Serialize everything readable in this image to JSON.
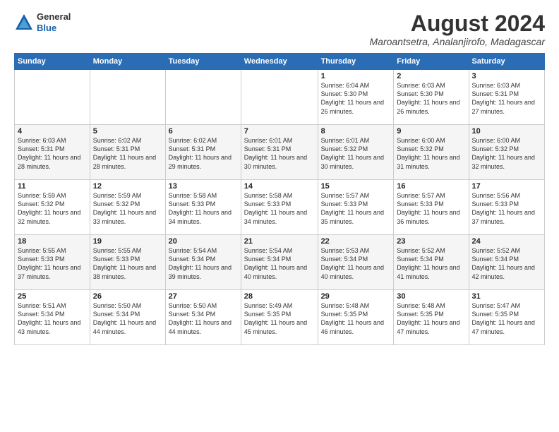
{
  "logo": {
    "general": "General",
    "blue": "Blue"
  },
  "title": {
    "month_year": "August 2024",
    "location": "Maroantsetra, Analanjirofo, Madagascar"
  },
  "days_of_week": [
    "Sunday",
    "Monday",
    "Tuesday",
    "Wednesday",
    "Thursday",
    "Friday",
    "Saturday"
  ],
  "weeks": [
    [
      {
        "day": "",
        "info": ""
      },
      {
        "day": "",
        "info": ""
      },
      {
        "day": "",
        "info": ""
      },
      {
        "day": "",
        "info": ""
      },
      {
        "day": "1",
        "info": "Sunrise: 6:04 AM\nSunset: 5:30 PM\nDaylight: 11 hours and 26 minutes."
      },
      {
        "day": "2",
        "info": "Sunrise: 6:03 AM\nSunset: 5:30 PM\nDaylight: 11 hours and 26 minutes."
      },
      {
        "day": "3",
        "info": "Sunrise: 6:03 AM\nSunset: 5:31 PM\nDaylight: 11 hours and 27 minutes."
      }
    ],
    [
      {
        "day": "4",
        "info": "Sunrise: 6:03 AM\nSunset: 5:31 PM\nDaylight: 11 hours and 28 minutes."
      },
      {
        "day": "5",
        "info": "Sunrise: 6:02 AM\nSunset: 5:31 PM\nDaylight: 11 hours and 28 minutes."
      },
      {
        "day": "6",
        "info": "Sunrise: 6:02 AM\nSunset: 5:31 PM\nDaylight: 11 hours and 29 minutes."
      },
      {
        "day": "7",
        "info": "Sunrise: 6:01 AM\nSunset: 5:31 PM\nDaylight: 11 hours and 30 minutes."
      },
      {
        "day": "8",
        "info": "Sunrise: 6:01 AM\nSunset: 5:32 PM\nDaylight: 11 hours and 30 minutes."
      },
      {
        "day": "9",
        "info": "Sunrise: 6:00 AM\nSunset: 5:32 PM\nDaylight: 11 hours and 31 minutes."
      },
      {
        "day": "10",
        "info": "Sunrise: 6:00 AM\nSunset: 5:32 PM\nDaylight: 11 hours and 32 minutes."
      }
    ],
    [
      {
        "day": "11",
        "info": "Sunrise: 5:59 AM\nSunset: 5:32 PM\nDaylight: 11 hours and 32 minutes."
      },
      {
        "day": "12",
        "info": "Sunrise: 5:59 AM\nSunset: 5:32 PM\nDaylight: 11 hours and 33 minutes."
      },
      {
        "day": "13",
        "info": "Sunrise: 5:58 AM\nSunset: 5:33 PM\nDaylight: 11 hours and 34 minutes."
      },
      {
        "day": "14",
        "info": "Sunrise: 5:58 AM\nSunset: 5:33 PM\nDaylight: 11 hours and 34 minutes."
      },
      {
        "day": "15",
        "info": "Sunrise: 5:57 AM\nSunset: 5:33 PM\nDaylight: 11 hours and 35 minutes."
      },
      {
        "day": "16",
        "info": "Sunrise: 5:57 AM\nSunset: 5:33 PM\nDaylight: 11 hours and 36 minutes."
      },
      {
        "day": "17",
        "info": "Sunrise: 5:56 AM\nSunset: 5:33 PM\nDaylight: 11 hours and 37 minutes."
      }
    ],
    [
      {
        "day": "18",
        "info": "Sunrise: 5:55 AM\nSunset: 5:33 PM\nDaylight: 11 hours and 37 minutes."
      },
      {
        "day": "19",
        "info": "Sunrise: 5:55 AM\nSunset: 5:33 PM\nDaylight: 11 hours and 38 minutes."
      },
      {
        "day": "20",
        "info": "Sunrise: 5:54 AM\nSunset: 5:34 PM\nDaylight: 11 hours and 39 minutes."
      },
      {
        "day": "21",
        "info": "Sunrise: 5:54 AM\nSunset: 5:34 PM\nDaylight: 11 hours and 40 minutes."
      },
      {
        "day": "22",
        "info": "Sunrise: 5:53 AM\nSunset: 5:34 PM\nDaylight: 11 hours and 40 minutes."
      },
      {
        "day": "23",
        "info": "Sunrise: 5:52 AM\nSunset: 5:34 PM\nDaylight: 11 hours and 41 minutes."
      },
      {
        "day": "24",
        "info": "Sunrise: 5:52 AM\nSunset: 5:34 PM\nDaylight: 11 hours and 42 minutes."
      }
    ],
    [
      {
        "day": "25",
        "info": "Sunrise: 5:51 AM\nSunset: 5:34 PM\nDaylight: 11 hours and 43 minutes."
      },
      {
        "day": "26",
        "info": "Sunrise: 5:50 AM\nSunset: 5:34 PM\nDaylight: 11 hours and 44 minutes."
      },
      {
        "day": "27",
        "info": "Sunrise: 5:50 AM\nSunset: 5:34 PM\nDaylight: 11 hours and 44 minutes."
      },
      {
        "day": "28",
        "info": "Sunrise: 5:49 AM\nSunset: 5:35 PM\nDaylight: 11 hours and 45 minutes."
      },
      {
        "day": "29",
        "info": "Sunrise: 5:48 AM\nSunset: 5:35 PM\nDaylight: 11 hours and 46 minutes."
      },
      {
        "day": "30",
        "info": "Sunrise: 5:48 AM\nSunset: 5:35 PM\nDaylight: 11 hours and 47 minutes."
      },
      {
        "day": "31",
        "info": "Sunrise: 5:47 AM\nSunset: 5:35 PM\nDaylight: 11 hours and 47 minutes."
      }
    ]
  ]
}
